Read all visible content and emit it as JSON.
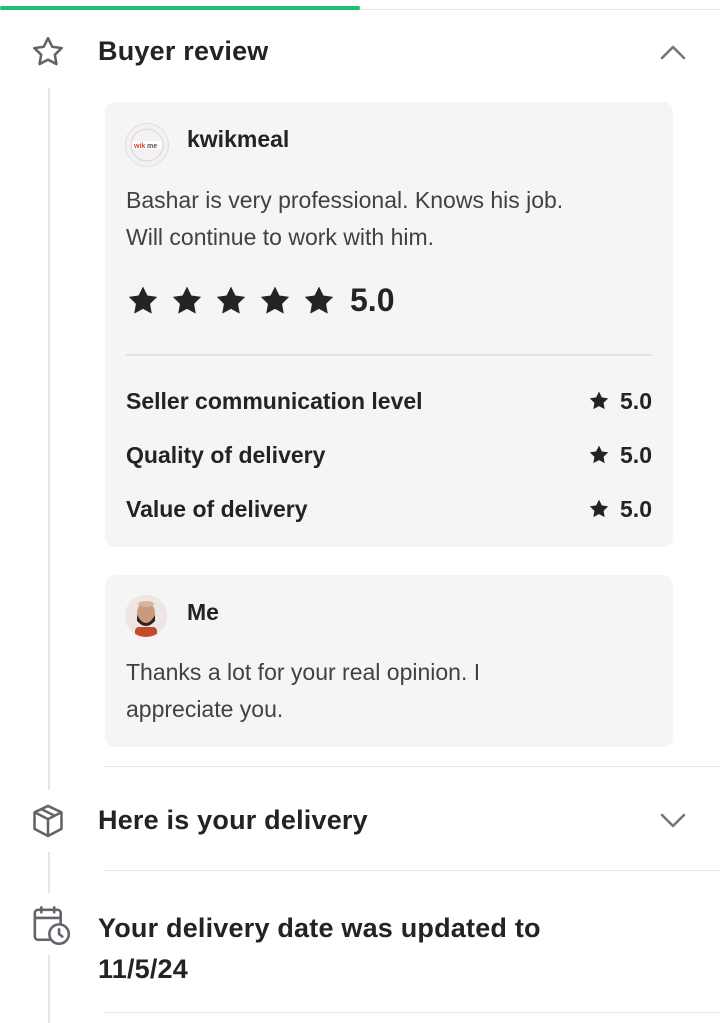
{
  "sections": {
    "buyer_review": {
      "title": "Buyer review",
      "icon": "star-outline-icon",
      "expanded": true
    },
    "delivery": {
      "title": "Here is your delivery",
      "icon": "package-icon",
      "expanded": false
    },
    "date_update": {
      "title_line1": "Your delivery date was updated to",
      "title_line2": "11/5/24",
      "icon": "calendar-clock-icon"
    }
  },
  "review": {
    "reviewer": "kwikmeal",
    "text_line1": "Bashar is very professional. Knows his job.",
    "text_line2": "Will continue to work with him.",
    "overall_score": "5.0",
    "stars": 5,
    "ratings": [
      {
        "label": "Seller communication level",
        "value": "5.0"
      },
      {
        "label": "Quality of delivery",
        "value": "5.0"
      },
      {
        "label": "Value of delivery",
        "value": "5.0"
      }
    ]
  },
  "reply": {
    "author": "Me",
    "text_line1": "Thanks a lot for your real opinion. I",
    "text_line2": "appreciate you."
  },
  "colors": {
    "accent": "#1dbf73",
    "text": "#222325",
    "card": "#f5f5f5"
  }
}
